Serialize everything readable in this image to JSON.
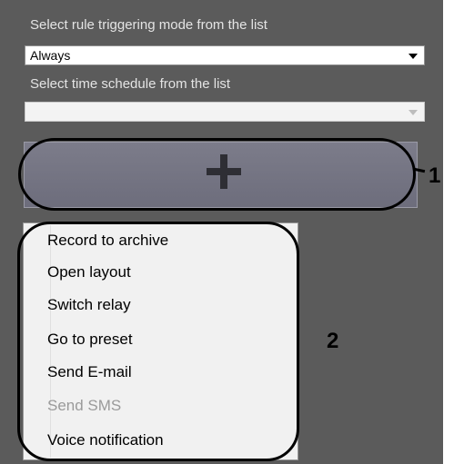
{
  "rules": {
    "trigger_mode_label": "Select rule triggering mode from the list",
    "trigger_mode_value": "Always",
    "schedule_label": "Select time schedule from the list",
    "schedule_value": ""
  },
  "add_button": {
    "icon": "plus-icon"
  },
  "callouts": {
    "one": "1",
    "two": "2"
  },
  "menu": {
    "items": [
      {
        "label": "Record to archive",
        "enabled": true
      },
      {
        "label": "Open layout",
        "enabled": true
      },
      {
        "label": "Switch relay",
        "enabled": true
      },
      {
        "label": "Go to preset",
        "enabled": true
      },
      {
        "label": "Send E-mail",
        "enabled": true
      },
      {
        "label": "Send SMS",
        "enabled": false
      },
      {
        "label": "Voice notification",
        "enabled": true
      }
    ]
  }
}
